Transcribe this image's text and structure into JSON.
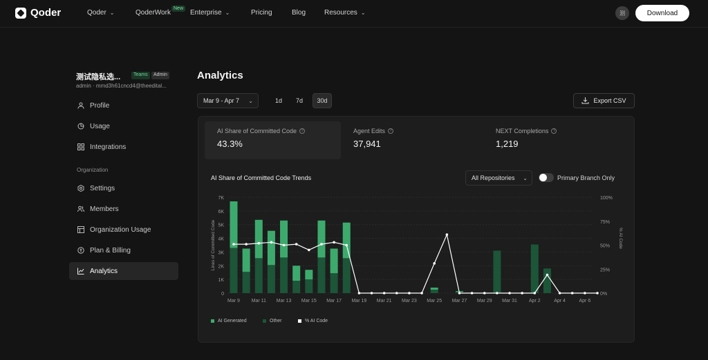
{
  "nav": {
    "logo": "Qoder",
    "items": [
      {
        "label": "Qoder",
        "dropdown": true
      },
      {
        "label": "QoderWork",
        "dropdown": false
      },
      {
        "label": "Enterprise",
        "dropdown": true
      },
      {
        "label": "Pricing",
        "dropdown": false
      },
      {
        "label": "Blog",
        "dropdown": false
      },
      {
        "label": "Resources",
        "dropdown": true
      }
    ],
    "new_badge": "New",
    "avatar": "测",
    "download": "Download"
  },
  "sidebar": {
    "workspace_name": "测试隐私选...",
    "badge_teams": "Teams",
    "badge_admin": "Admin",
    "email": "admin · mmd3h61cncd4@theedital...",
    "items": [
      {
        "label": "Profile",
        "icon": "user-icon"
      },
      {
        "label": "Usage",
        "icon": "pie-icon"
      },
      {
        "label": "Integrations",
        "icon": "grid-icon"
      }
    ],
    "section_label": "Organization",
    "org_items": [
      {
        "label": "Settings",
        "icon": "gear-icon"
      },
      {
        "label": "Members",
        "icon": "users-icon"
      },
      {
        "label": "Organization Usage",
        "icon": "table-icon"
      },
      {
        "label": "Plan & Billing",
        "icon": "billing-icon"
      },
      {
        "label": "Analytics",
        "icon": "chart-icon",
        "active": true
      }
    ]
  },
  "main": {
    "title": "Analytics",
    "date_range": "Mar 9 - Apr 7",
    "ranges": [
      "1d",
      "7d",
      "30d"
    ],
    "active_range": "30d",
    "export": "Export CSV",
    "metrics": [
      {
        "label": "AI Share of Committed Code",
        "value": "43.3%"
      },
      {
        "label": "Agent Edits",
        "value": "37,941"
      },
      {
        "label": "NEXT Completions",
        "value": "1,219"
      }
    ],
    "trend_title": "AI Share of Committed Code Trends",
    "repo_filter": "All Repositories",
    "primary_branch_only": "Primary Branch Only",
    "primary_branch_enabled": false
  },
  "chart_data": {
    "type": "bar",
    "categories": [
      "Mar 9",
      "Mar 10",
      "Mar 11",
      "Mar 12",
      "Mar 13",
      "Mar 14",
      "Mar 15",
      "Mar 16",
      "Mar 17",
      "Mar 18",
      "Mar 19",
      "Mar 20",
      "Mar 21",
      "Mar 22",
      "Mar 23",
      "Mar 24",
      "Mar 25",
      "Mar 26",
      "Mar 27",
      "Mar 28",
      "Mar 29",
      "Mar 30",
      "Mar 31",
      "Apr 1",
      "Apr 2",
      "Apr 3",
      "Apr 4",
      "Apr 5",
      "Apr 6",
      "Apr 7"
    ],
    "x_tick_labels": [
      "Mar 9",
      "Mar 11",
      "Mar 13",
      "Mar 15",
      "Mar 17",
      "Mar 19",
      "Mar 21",
      "Mar 23",
      "Mar 25",
      "Mar 27",
      "Mar 29",
      "Mar 31",
      "Apr 2",
      "Apr 4",
      "Apr 6"
    ],
    "series": [
      {
        "name": "AI Generated",
        "color": "#3daa6d",
        "values": [
          3400,
          1700,
          2800,
          2500,
          2700,
          1100,
          700,
          2700,
          1800,
          2600,
          0,
          0,
          0,
          0,
          0,
          0,
          150,
          0,
          50,
          0,
          0,
          0,
          0,
          0,
          0,
          0,
          0,
          0,
          0,
          0
        ]
      },
      {
        "name": "Other",
        "color": "#1c5538",
        "values": [
          3300,
          1550,
          2550,
          2050,
          2600,
          900,
          1000,
          2600,
          1450,
          2550,
          0,
          0,
          0,
          0,
          0,
          0,
          250,
          0,
          100,
          0,
          0,
          3100,
          0,
          0,
          3550,
          1800,
          0,
          0,
          0,
          0
        ]
      },
      {
        "name": "% AI Code",
        "color": "#ffffff",
        "values": [
          51,
          51,
          52,
          53,
          50,
          51,
          45,
          51,
          53,
          50,
          0,
          0,
          0,
          0,
          0,
          0,
          31,
          61,
          0,
          0,
          0,
          0,
          0,
          0,
          0,
          19,
          0,
          0,
          0,
          0
        ]
      }
    ],
    "ylabel": "Lines of Committed Code",
    "y2label": "% AI Code",
    "ylim": [
      0,
      7000
    ],
    "y_ticks": [
      "0",
      "1K",
      "2K",
      "3K",
      "4K",
      "5K",
      "6K",
      "7K"
    ],
    "y2lim": [
      0,
      100
    ],
    "y2_ticks": [
      "0%",
      "25%",
      "50%",
      "75%",
      "100%"
    ],
    "legend_position": "bottom-left",
    "grid": true
  }
}
